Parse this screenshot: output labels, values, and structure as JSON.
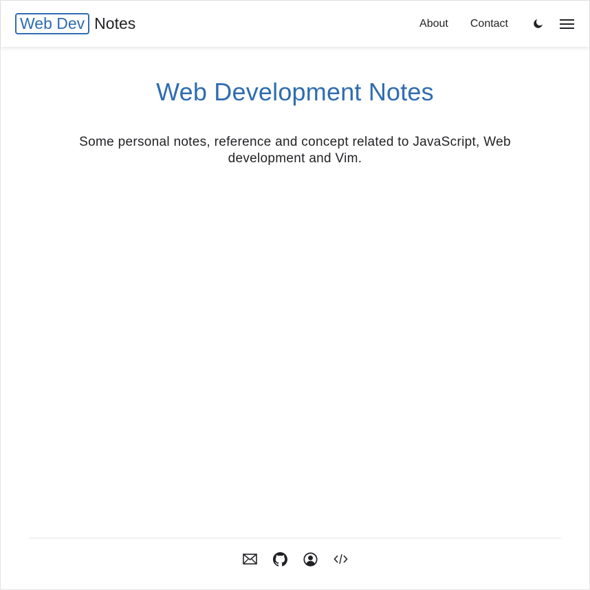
{
  "header": {
    "logo_box": "Web Dev",
    "logo_text": "Notes",
    "nav": [
      {
        "label": "About"
      },
      {
        "label": "Contact"
      }
    ],
    "icons": {
      "theme": "moon-icon",
      "menu": "hamburger-menu-icon"
    }
  },
  "hero": {
    "title": "Web Development Notes",
    "description": "Some personal notes, reference and concept related to JavaScript, Web development and Vim."
  },
  "footer": {
    "icons": [
      "mail-icon",
      "github-icon",
      "user-circle-icon",
      "code-icon"
    ]
  },
  "colors": {
    "accent": "#2f6cb0",
    "text": "#222226",
    "divider": "#e5e5e5"
  }
}
